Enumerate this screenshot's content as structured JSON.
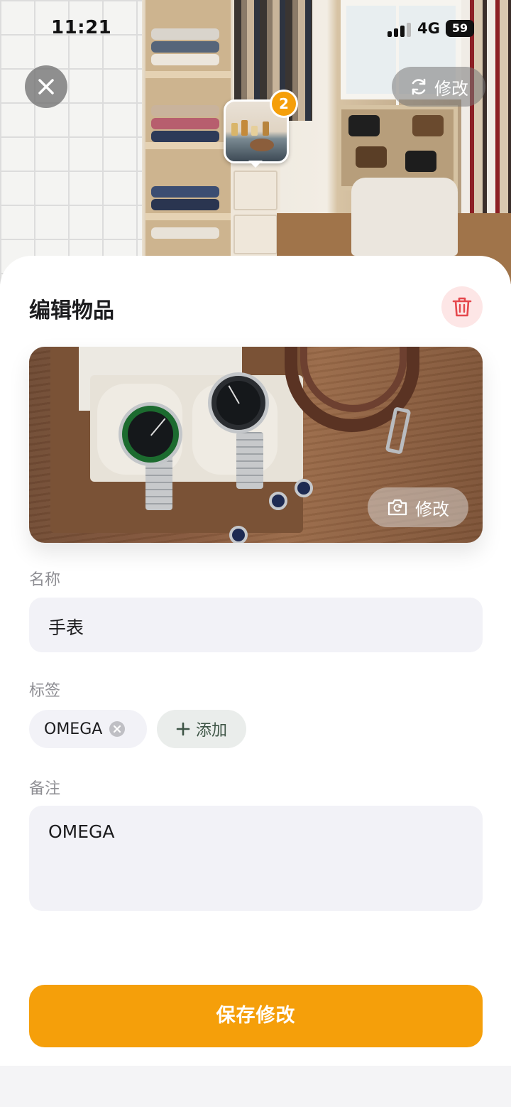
{
  "status_bar": {
    "time": "11:21",
    "network": "4G",
    "battery": "59"
  },
  "scene": {
    "edit_label": "修改",
    "item_count": "2",
    "icons": {
      "close": "close-icon",
      "refresh": "refresh-icon"
    }
  },
  "sheet": {
    "title": "编辑物品",
    "photo_edit_label": "修改",
    "name_label": "名称",
    "name_value": "手表",
    "tags_label": "标签",
    "tags": [
      "OMEGA"
    ],
    "add_tag_label": "添加",
    "note_label": "备注",
    "note_value": "OMEGA",
    "save_label": "保存修改",
    "icons": {
      "delete": "trash-icon",
      "camera": "camera-icon",
      "plus": "plus-icon",
      "remove": "remove-tag-icon"
    }
  },
  "colors": {
    "accent": "#f59f0a",
    "danger": "#e5484d",
    "danger_bg": "#fde6e6",
    "field_bg": "#f2f2f7",
    "add_chip_fg": "#3e5546"
  }
}
